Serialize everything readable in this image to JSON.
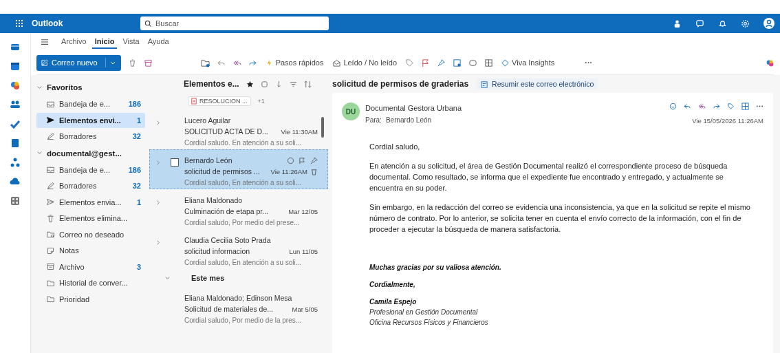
{
  "topbar": {
    "app_name": "Outlook",
    "search": {
      "placeholder": "Buscar"
    }
  },
  "ribbon": {
    "tabs": [
      {
        "label": "Archivo",
        "selected": false
      },
      {
        "label": "Inicio",
        "selected": true
      },
      {
        "label": "Vista",
        "selected": false
      },
      {
        "label": "Ayuda",
        "selected": false
      }
    ],
    "new_mail": "Correo nuevo",
    "quick_steps": "Pasos rápidos",
    "read_unread": "Leído / No leído",
    "viva": "Viva Insights",
    "more": "···"
  },
  "folders": {
    "groups": [
      {
        "title": "Favoritos",
        "items": [
          {
            "kind": "inbox",
            "label": "Bandeja de e...",
            "count": "186",
            "selected": false
          },
          {
            "kind": "send",
            "label": "Elementos envi...",
            "count": "1",
            "selected": true
          },
          {
            "kind": "draft",
            "label": "Borradores",
            "count": "32",
            "selected": false
          }
        ]
      },
      {
        "title": "documental@gest...",
        "items": [
          {
            "kind": "inbox",
            "label": "Bandeja de e...",
            "count": "186",
            "selected": false
          },
          {
            "kind": "draft",
            "label": "Borradores",
            "count": "32",
            "selected": false
          },
          {
            "kind": "sent",
            "label": "Elementos envia...",
            "count": "1",
            "selected": false
          },
          {
            "kind": "trash",
            "label": "Elementos elimina...",
            "selected": false
          },
          {
            "kind": "junk",
            "label": "Correo no deseado",
            "selected": false
          },
          {
            "kind": "note",
            "label": "Notas",
            "selected": false
          },
          {
            "kind": "archive",
            "label": "Archivo",
            "count": "3",
            "selected": false
          },
          {
            "kind": "folder",
            "label": "Historial de conver...",
            "selected": false
          },
          {
            "kind": "folder",
            "label": "Prioridad",
            "selected": false
          }
        ]
      }
    ]
  },
  "message_list": {
    "title": "Elementos e...",
    "items": [
      {
        "kind": "attachment",
        "file": "RESOLUCION ...",
        "extra": "+1"
      },
      {
        "kind": "message",
        "sender": "Lucero Aguilar",
        "subject": "SOLICITUD ACTA DE D...",
        "date": "Vie 11:30AM",
        "preview": "Cordial saludo. En atención a su soli...",
        "expandable": true,
        "selected": false
      },
      {
        "kind": "message",
        "sender": "Bernardo León",
        "subject": "solicitud de permisos ...",
        "date": "Vie 11:26AM",
        "preview": "Cordial saludo, En atención a su soli...",
        "expandable": true,
        "selected": true
      },
      {
        "kind": "message",
        "sender": "Eliana Maldonado",
        "subject": "Culminación de etapa pr...",
        "date": "Mar 12/05",
        "preview": "Cordial saludo, Por medio del prese...",
        "expandable": true,
        "selected": false
      },
      {
        "kind": "message",
        "sender": "Claudia Cecilia Soto Prada",
        "subject": "solicitud informacion",
        "date": "Lun 11/05",
        "preview": "Cordial saludo, En atención a su soli...",
        "expandable": true,
        "selected": false
      },
      {
        "kind": "group",
        "label": "Este mes"
      },
      {
        "kind": "message",
        "sender": "Eliana Maldonado; Edinson Mesa",
        "subject": "Solicitud de materiales de...",
        "date": "Mar 5/05",
        "preview": "Cordial saludo, Por medio de la pres...",
        "expandable": false,
        "selected": false
      }
    ]
  },
  "reading": {
    "subject": "solicitud de permisos de graderias",
    "summarize": "Resumir este correo electrónico",
    "avatar": "DU",
    "sender": "Documental Gestora Urbana",
    "to_label": "Para:",
    "to": "Bernardo León",
    "date": "Vie 15/05/2026 11:26AM",
    "greeting": "Cordial saludo,",
    "paragraphs": [
      "En atención a su solicitud, el área de Gestión Documental realizó el correspondiente proceso de búsqueda documental. Como resultado, se informa que el expediente fue encontrado y entregado, y actualmente se encuentra en su poder.",
      "Sin embargo, en la redacción del correo se evidencia una inconsistencia, ya que en la solicitud se repite el mismo número de contrato. Por lo anterior, se solicita tener en cuenta el envío correcto de la información, con el fin de proceder a ejecutar la búsqueda de manera satisfactoria."
    ],
    "thanks": "Muchas gracias por su valiosa atención.",
    "closing": "Cordialmente,",
    "signature": {
      "name": "Camila Espejo",
      "title": "Profesional en Gestión Documental",
      "office": "Oficina Recursos Físicos y Financieros"
    }
  }
}
